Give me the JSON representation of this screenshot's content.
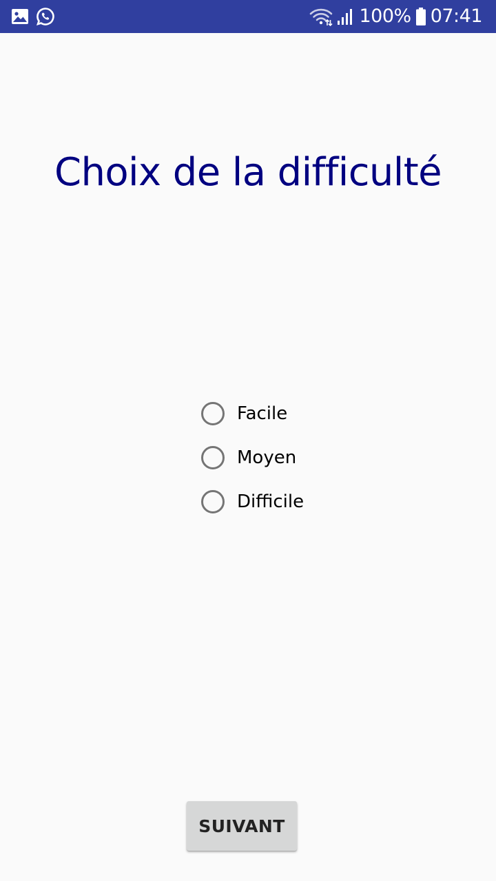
{
  "status_bar": {
    "battery_percent": "100%",
    "time": "07:41",
    "background_color": "#303f9f",
    "icons_left": [
      "gallery-icon",
      "whatsapp-icon"
    ],
    "icons_right": [
      "wifi-icon",
      "signal-icon",
      "battery-icon"
    ]
  },
  "screen": {
    "title": "Choix de la difficulté",
    "title_color": "#000080",
    "background_color": "#fafafa"
  },
  "difficulty_options": [
    {
      "label": "Facile",
      "selected": false
    },
    {
      "label": "Moyen",
      "selected": false
    },
    {
      "label": "Difficile",
      "selected": false
    }
  ],
  "next_button": {
    "label": "SUIVANT"
  }
}
